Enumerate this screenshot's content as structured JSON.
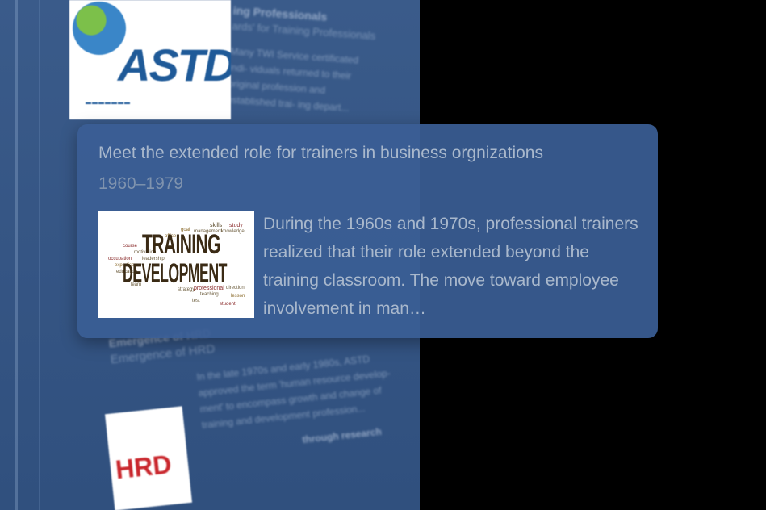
{
  "background": {
    "card_top": {
      "title": "ing Professionals",
      "subtitle": "ards' for Training Professionals",
      "body": "Many TWI Service certificated indi- viduals returned to their original profession and established trai- ing depart..."
    },
    "astd_logo": {
      "text": "ASTD"
    },
    "card_bottom": {
      "title": "Emergence of HRD",
      "subtitle": "Emergence of HRD",
      "body": "In the late 1970s and early 1980s, ASTD approved the term 'human resource develop- ment' to encompass growth and change of training and development profession...",
      "next_title": "through research"
    },
    "hrd_logo": {
      "text": "HRD"
    }
  },
  "card": {
    "title": "Meet the extended role for trainers in business orgnizations",
    "date": "1960–1979",
    "description": "During the 1960s and 1970s, professional trainers realized that their role extended beyond the training classroom. The move toward employee involvement in man…",
    "image": {
      "headline_1": "TRAINING",
      "headline_2": "DEVELOPMENT",
      "words": [
        "skills",
        "study",
        "management",
        "knowledge",
        "office",
        "goal",
        "course",
        "motivation",
        "leadership",
        "occupation",
        "expertise",
        "education",
        "learn",
        "strategy",
        "professional",
        "direction",
        "teaching",
        "lesson",
        "test",
        "student"
      ]
    }
  },
  "colors": {
    "panel": "#355584",
    "card": "#3a5e94",
    "text": "#a9b8cc",
    "date": "#7f93ae"
  }
}
